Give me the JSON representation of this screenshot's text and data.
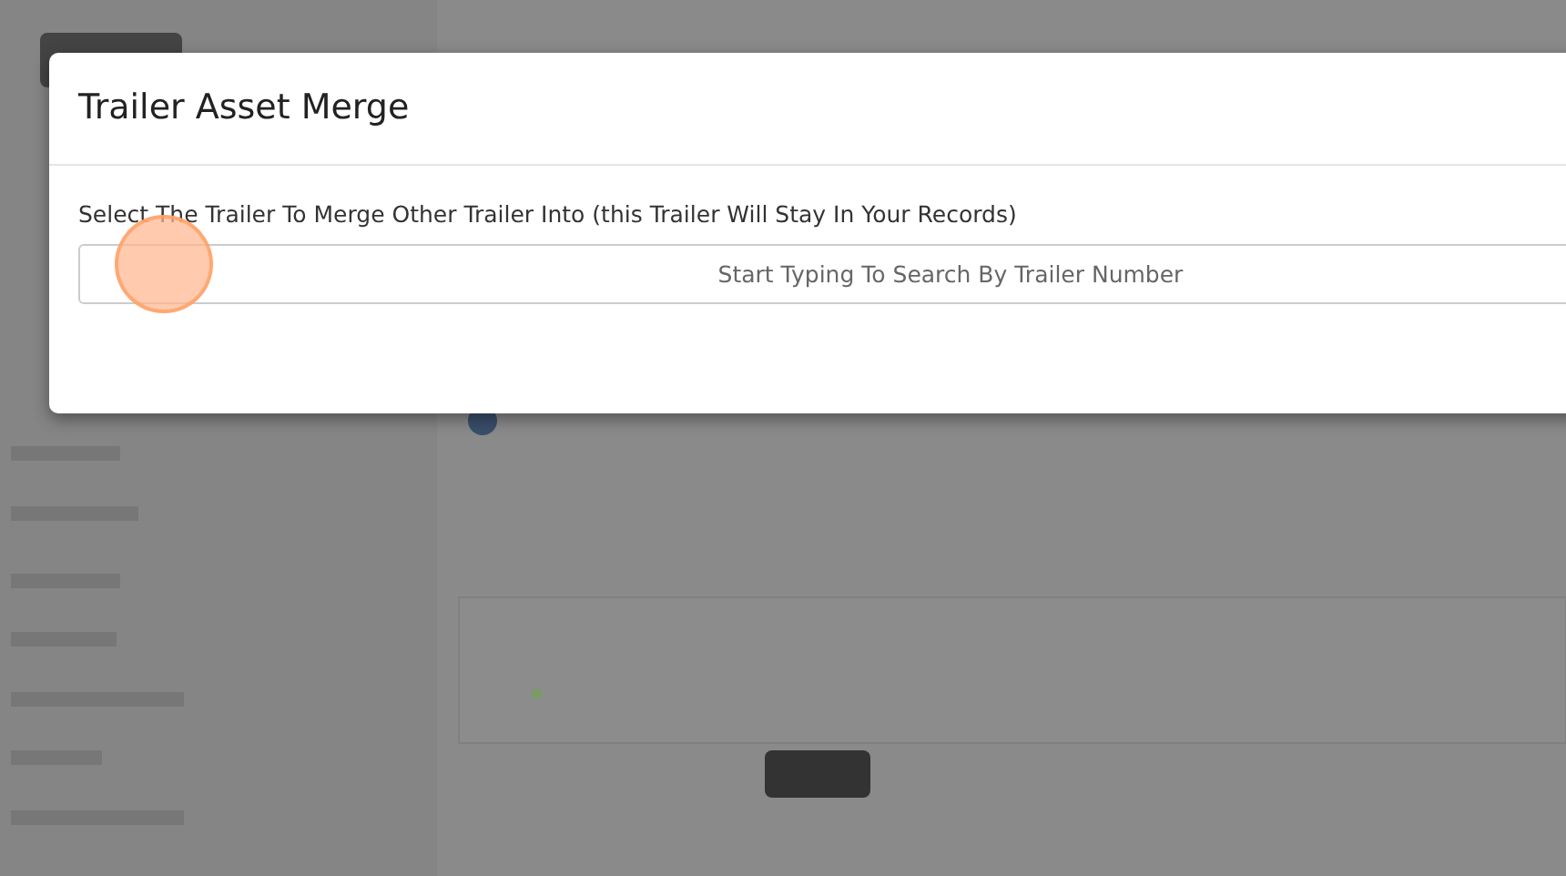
{
  "modal": {
    "title": "Trailer Asset Merge",
    "field_label": "Select The Trailer To Merge Other Trailer Into (this Trailer Will Stay In Your Records)",
    "search": {
      "placeholder": "Start Typing To Search By Trailer Number"
    }
  },
  "click_indicator": {
    "shown": true
  }
}
